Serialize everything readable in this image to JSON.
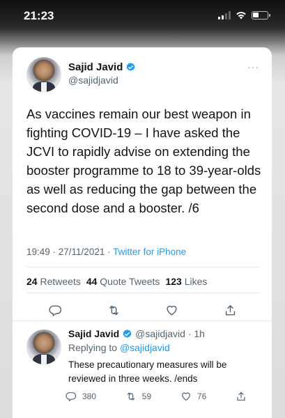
{
  "status_bar": {
    "time": "21:23"
  },
  "tweet": {
    "author_name": "Sajid Javid",
    "handle": "@sajidjavid",
    "more": "···",
    "text": "As vaccines remain our best weapon in fighting COVID-19 – I have asked the JCVI to rapidly advise on extending the booster programme to 18 to 39-year-olds as well as reducing the gap between the second dose and a booster. /6",
    "timestamp": "19:49 · 27/11/2021 · ",
    "source": "Twitter for iPhone",
    "stats": {
      "retweets_count": "24",
      "retweets_label": "Retweets",
      "quotes_count": "44",
      "quotes_label": "Quote Tweets",
      "likes_count": "123",
      "likes_label": "Likes"
    }
  },
  "reply": {
    "author_name": "Sajid Javid",
    "handle_time": "@sajidjavid · 1h",
    "replying_prefix": "Replying to ",
    "replying_to": "@sajidjavid",
    "text": "These precautionary measures will be reviewed in three weeks. /ends",
    "replies": "380",
    "retweets": "59",
    "likes": "76"
  },
  "colors": {
    "accent": "#1d9bf0",
    "text": "#0f1419",
    "muted": "#536471"
  }
}
